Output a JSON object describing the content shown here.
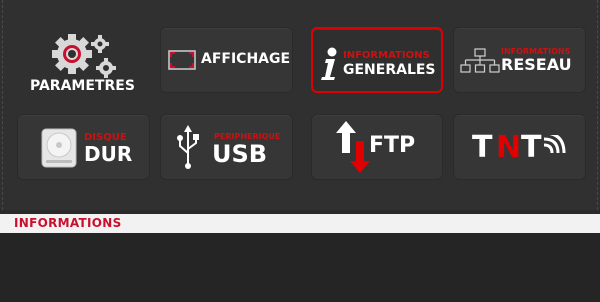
{
  "menu": {
    "parametres": {
      "label": "PARAMETRES"
    },
    "affichage": {
      "label": "AFFICHAGE"
    },
    "informations_generales": {
      "top": "INFORMATIONS",
      "bottom": "GENERALES"
    },
    "informations_reseau": {
      "top": "INFORMATIONS",
      "bottom": "RESEAU"
    },
    "disque_dur": {
      "top": "DISQUE",
      "bottom": "DUR"
    },
    "peripherique_usb": {
      "top": "PERIPHERIQUE",
      "bottom": "USB"
    },
    "ftp": {
      "label": "FTP"
    },
    "tnt": {
      "letter1": "T",
      "letter2": "N",
      "letter3": "T"
    }
  },
  "info_bar": {
    "title": "INFORMATIONS"
  },
  "colors": {
    "accent": "#e00000",
    "tile": "#363636",
    "background": "#2a2a2a"
  },
  "icons": [
    "gears-icon",
    "screen-frame-icon",
    "info-i-icon",
    "network-icon",
    "hard-disk-icon",
    "usb-icon",
    "transfer-arrows-icon",
    "broadcast-waves-icon"
  ]
}
